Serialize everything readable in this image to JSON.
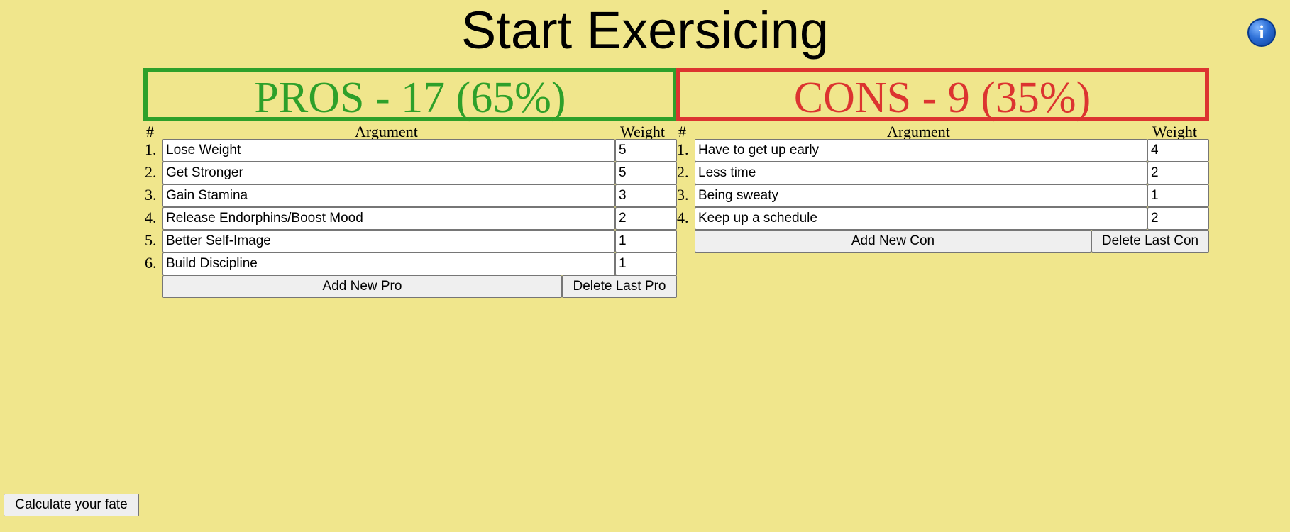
{
  "title": "Start Exersicing",
  "info_icon": "info-icon",
  "columns": {
    "number": "#",
    "argument": "Argument",
    "weight": "Weight"
  },
  "pros": {
    "header": "PROS - 17 (65%)",
    "color": "#2ea02a",
    "items": [
      {
        "num": "1.",
        "argument": "Lose Weight",
        "weight": "5"
      },
      {
        "num": "2.",
        "argument": "Get Stronger",
        "weight": "5"
      },
      {
        "num": "3.",
        "argument": "Gain Stamina",
        "weight": "3"
      },
      {
        "num": "4.",
        "argument": "Release Endorphins/Boost Mood",
        "weight": "2"
      },
      {
        "num": "5.",
        "argument": "Better Self-Image",
        "weight": "1"
      },
      {
        "num": "6.",
        "argument": "Build Discipline",
        "weight": "1"
      }
    ],
    "add_label": "Add New Pro",
    "delete_label": "Delete Last Pro"
  },
  "cons": {
    "header": "CONS - 9 (35%)",
    "color": "#dc3430",
    "items": [
      {
        "num": "1.",
        "argument": "Have to get up early",
        "weight": "4"
      },
      {
        "num": "2.",
        "argument": "Less time",
        "weight": "2"
      },
      {
        "num": "3.",
        "argument": "Being sweaty",
        "weight": "1"
      },
      {
        "num": "4.",
        "argument": "Keep up a schedule",
        "weight": "2"
      }
    ],
    "add_label": "Add New Con",
    "delete_label": "Delete Last Con"
  },
  "calculate_label": "Calculate your fate"
}
